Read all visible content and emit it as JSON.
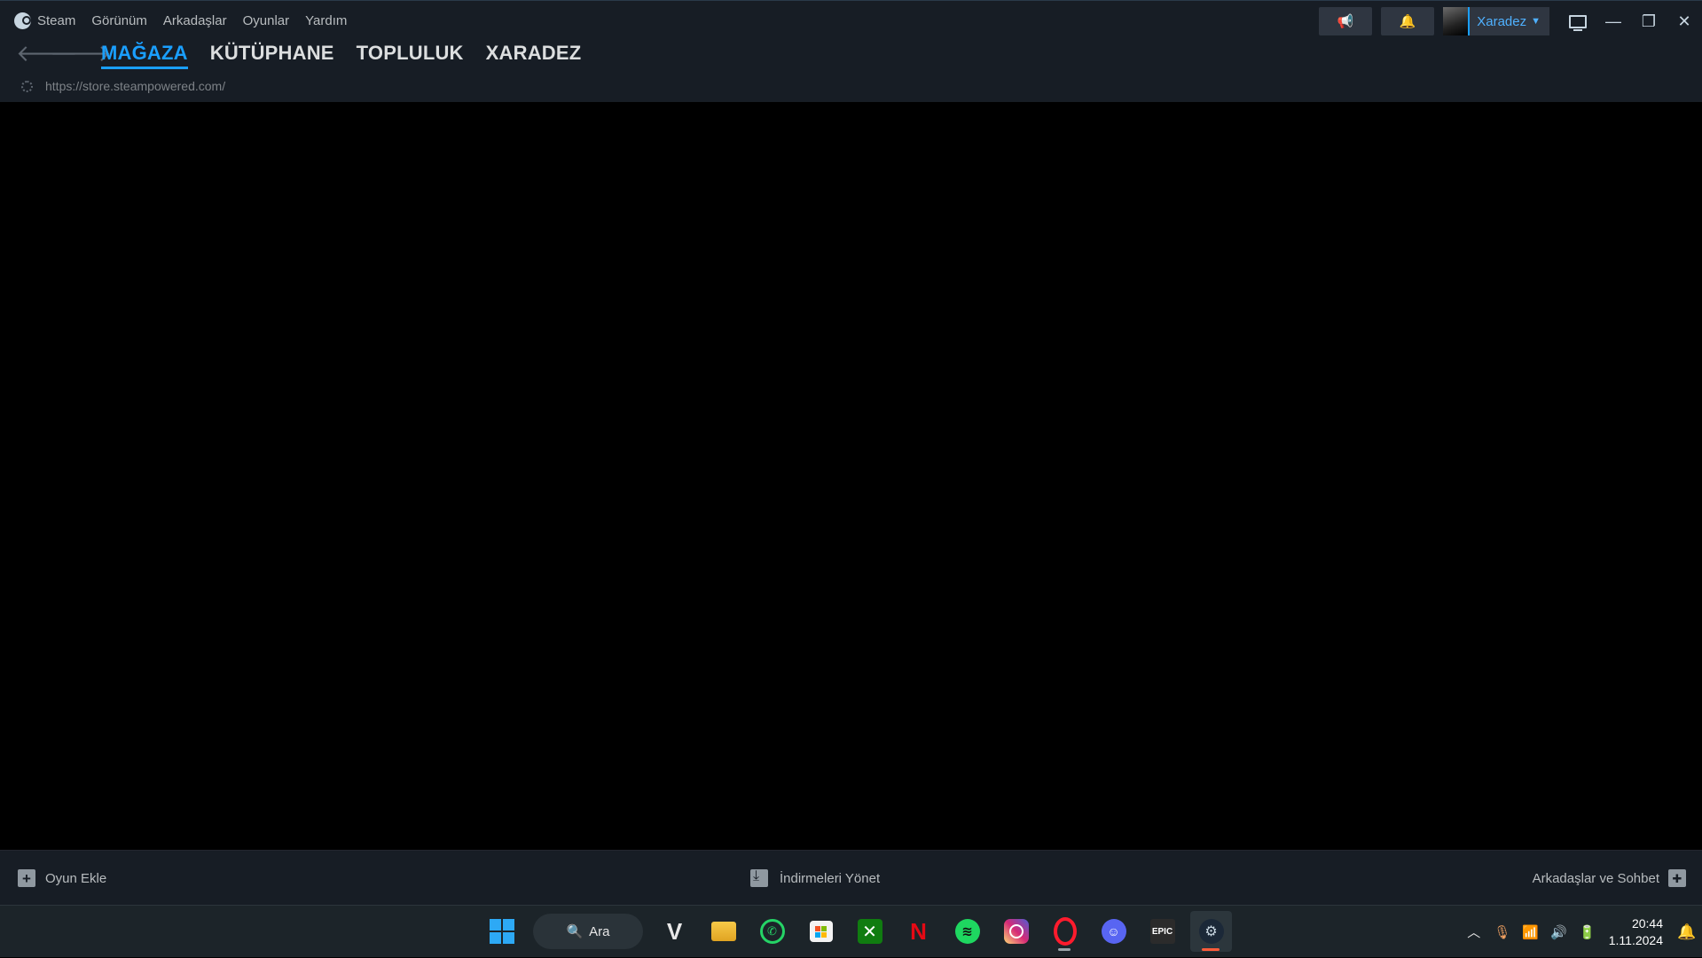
{
  "menu": {
    "brand": "Steam",
    "items": [
      "Görünüm",
      "Arkadaşlar",
      "Oyunlar",
      "Yardım"
    ]
  },
  "nav": {
    "tabs": [
      {
        "label": "MAĞAZA",
        "active": true
      },
      {
        "label": "KÜTÜPHANE",
        "active": false
      },
      {
        "label": "TOPLULUK",
        "active": false
      },
      {
        "label": "XARADEZ",
        "active": false
      }
    ]
  },
  "url": "https://store.steampowered.com/",
  "user": {
    "name": "Xaradez"
  },
  "bottom": {
    "add_game": "Oyun Ekle",
    "downloads": "İndirmeleri Yönet",
    "friends": "Arkadaşlar ve Sohbet"
  },
  "taskbar": {
    "search_label": "Ara",
    "time": "20:44",
    "date": "1.11.2024",
    "apps": [
      {
        "name": "start",
        "icon": "windows-icon"
      },
      {
        "name": "vivaldi",
        "icon": "v-icon"
      },
      {
        "name": "file-explorer",
        "icon": "folder-icon"
      },
      {
        "name": "whatsapp",
        "icon": "whatsapp-icon"
      },
      {
        "name": "microsoft-store",
        "icon": "store-icon"
      },
      {
        "name": "xbox",
        "icon": "xbox-icon"
      },
      {
        "name": "netflix",
        "icon": "netflix-icon"
      },
      {
        "name": "spotify",
        "icon": "spotify-icon"
      },
      {
        "name": "instagram",
        "icon": "instagram-icon"
      },
      {
        "name": "opera",
        "icon": "opera-icon"
      },
      {
        "name": "discord",
        "icon": "discord-icon"
      },
      {
        "name": "epic-games",
        "icon": "epic-icon",
        "label": "EPIC"
      },
      {
        "name": "steam",
        "icon": "steam-icon"
      }
    ]
  },
  "colors": {
    "accent": "#1a9fff",
    "header_bg": "#171d25",
    "taskbar_bg": "#1c2429"
  }
}
